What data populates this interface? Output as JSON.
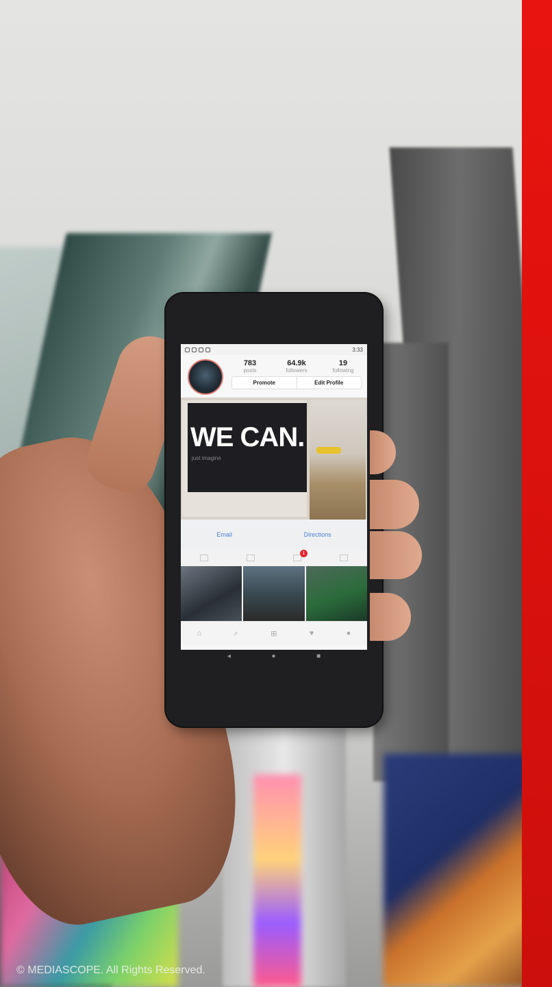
{
  "phone": {
    "status_bar": {
      "time": "3:33"
    },
    "profile": {
      "stats": [
        {
          "value": "783",
          "label": "posts"
        },
        {
          "value": "64.9k",
          "label": "followers"
        },
        {
          "value": "19",
          "label": "following"
        }
      ],
      "promote_label": "Promote",
      "edit_profile_label": "Edit Profile"
    },
    "hero": {
      "headline": "WE CAN.",
      "subline": "just imagine"
    },
    "contact": {
      "email_label": "Email",
      "directions_label": "Directions"
    },
    "tabs": {
      "notification_count": "1"
    },
    "system_nav": {
      "back": "◂",
      "home": "●",
      "recent": "■"
    }
  },
  "footer": {
    "copyright": "© MEDIASCOPE. All Rights Reserved."
  },
  "colors": {
    "accent_red": "#e8140f",
    "link_blue": "#4f7fd0",
    "badge_red": "#e0262e"
  }
}
